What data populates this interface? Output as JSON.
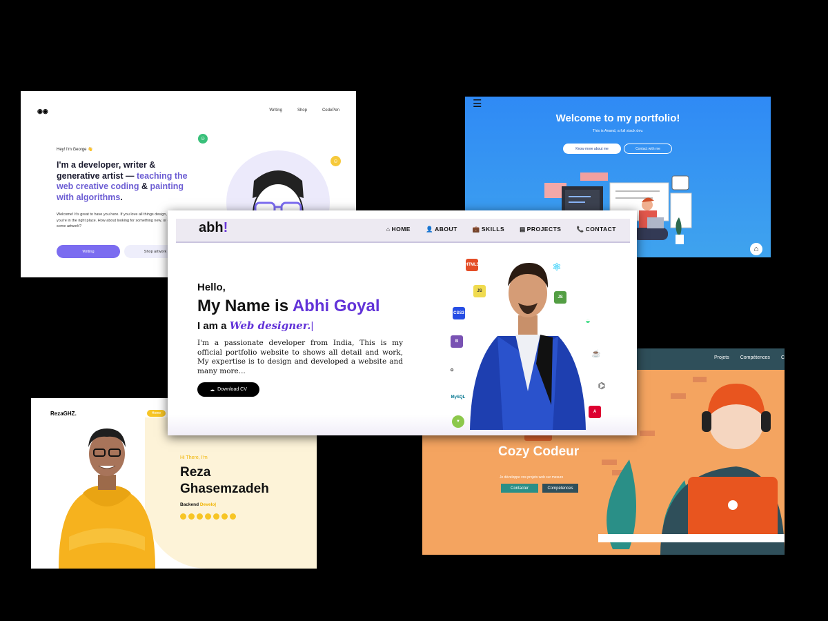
{
  "george": {
    "logo": "◉◉",
    "nav": [
      "Writing",
      "Shop",
      "CodePen"
    ],
    "greeting": "Hey! I'm George 👋",
    "headline_plain": "I'm a developer, writer & generative artist — ",
    "headline_highlight": "teaching the web creative coding",
    "headline_amp": " & ",
    "headline_highlight2": "painting with algorithms",
    "headline_end": ".",
    "welcome": "Welcome! It's great to have you here. If you love all things design, and code — you're in the right place. How about looking for something new, or checking out some artwork?",
    "button_primary": "Writing",
    "button_secondary": "Shop artwork"
  },
  "anand": {
    "title": "Welcome to my portfolio!",
    "subtitle": "This is Anand, a full stack dev.",
    "button_primary": "Know more about me",
    "button_secondary": "Contact with me"
  },
  "reza": {
    "brand": "RezaGHZ.",
    "nav_home": "Home",
    "greeting": "Hi There, I'm",
    "first_name": "Reza",
    "last_name": "Ghasemzadeh",
    "role_prefix": "Backend ",
    "role_typed": "Develo|"
  },
  "cozy": {
    "nav": [
      "Projets",
      "Compétences",
      "C"
    ],
    "title": "Cozy Codeur",
    "subtitle": "Je développe vos projets web sur mesure",
    "button_primary": "Contacter",
    "button_secondary": "Compétences"
  },
  "abh": {
    "logo": "abh",
    "logo_mark": "!",
    "nav": [
      {
        "icon": "⌂",
        "label": "HOME"
      },
      {
        "icon": "👤",
        "label": "ABOUT"
      },
      {
        "icon": "💼",
        "label": "SKILLS"
      },
      {
        "icon": "▤",
        "label": "PROJECTS"
      },
      {
        "icon": "📞",
        "label": "CONTACT"
      }
    ],
    "hello": "Hello,",
    "name_prefix": "My Name is ",
    "name": "Abhi Goyal",
    "role_prefix": "I am a ",
    "role_typed": "Web designer.",
    "cursor": "|",
    "description": "I'm a passionate developer from India, This is my official portfolio website to shows all detail and work, My expertise is to design and developed a website and many more...",
    "download_button": "Download CV",
    "tech_icons": [
      "HTML5",
      "JS",
      "CSS3",
      "B",
      "GitHub",
      "MySQL",
      "React",
      "Node.js",
      "Android",
      "Java",
      "Python",
      "Angular"
    ]
  },
  "colors": {
    "accent_purple": "#6233d8",
    "george_purple": "#7b6cf0",
    "anand_blue": "#2f8af5",
    "reza_yellow": "#f7c525",
    "cozy_orange": "#f4a460",
    "cozy_teal": "#2a8f87"
  }
}
